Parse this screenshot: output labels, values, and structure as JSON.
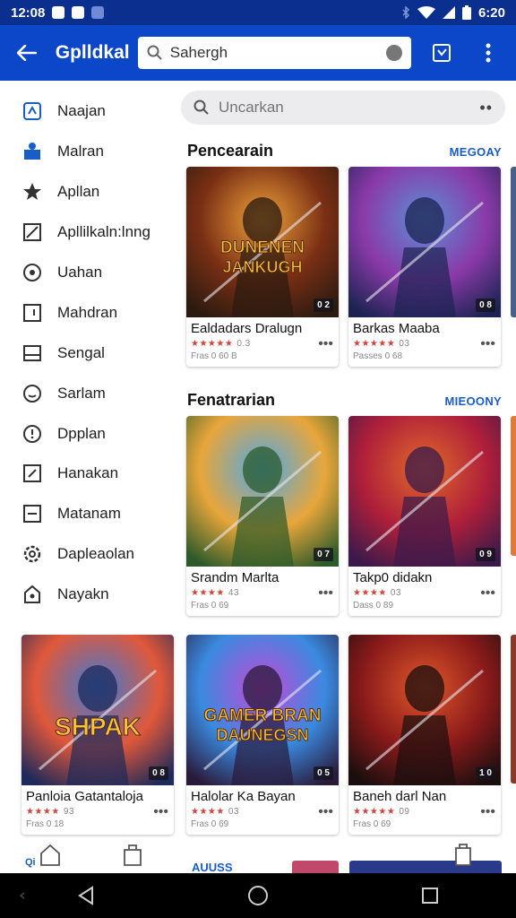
{
  "status_bar": {
    "time_left": "12:08",
    "time_right": "6:20",
    "icons": [
      "notification-icon",
      "notification-icon",
      "image-icon",
      "bluetooth-icon",
      "wifi-icon",
      "signal-icon",
      "battery-icon"
    ]
  },
  "app_bar": {
    "title": "Gplldkal",
    "search_value": "Sahergh",
    "icons": [
      "back-arrow-icon",
      "search-icon",
      "mic-icon",
      "bookmark-icon",
      "more-vert-icon"
    ]
  },
  "sidebar": {
    "items": [
      {
        "label": "Naajan",
        "icon": "home-icon"
      },
      {
        "label": "Malran",
        "icon": "store-icon"
      },
      {
        "label": "Apllan",
        "icon": "star-icon"
      },
      {
        "label": "Apllilkaln:lnng",
        "icon": "pencil-icon"
      },
      {
        "label": "Uahan",
        "icon": "compass-icon"
      },
      {
        "label": "Mahdran",
        "icon": "bookmark-icon"
      },
      {
        "label": "Sengal",
        "icon": "inbox-icon"
      },
      {
        "label": "Sarlam",
        "icon": "smile-icon"
      },
      {
        "label": "Dpplan",
        "icon": "info-icon"
      },
      {
        "label": "Hanakan",
        "icon": "edit-icon"
      },
      {
        "label": "Matanam",
        "icon": "minus-icon"
      },
      {
        "label": "Dapleaolan",
        "icon": "settings-icon"
      },
      {
        "label": "Nayakn",
        "icon": "bag-icon"
      }
    ]
  },
  "secondary_search": {
    "placeholder": "Uncarkan",
    "icons": [
      "search-icon",
      "more-horiz-icon"
    ]
  },
  "sections": [
    {
      "title": "Pencearain",
      "more": "MEGOAY"
    },
    {
      "title": "Fenatrarian",
      "more": "MIEOONY"
    }
  ],
  "cards": [
    {
      "name": "Ealdadars Dralugn",
      "stars": "★★★★★",
      "rating": "0.3",
      "sub": "Fras 0 60 B",
      "badge": "0 2",
      "art_title": "DUNENEN JANKUGH",
      "colors": [
        "#f0a33a",
        "#7a2f14",
        "#2a1a10"
      ]
    },
    {
      "name": "Barkas Maaba",
      "stars": "★★★★★",
      "rating": "03",
      "sub": "Passes 0 68",
      "badge": "0 8",
      "art_title": "",
      "colors": [
        "#5b8fd6",
        "#8a3aa8",
        "#1c2352"
      ]
    },
    {
      "name": "Srandm Marlta",
      "stars": "★★★★",
      "rating": "43",
      "sub": "Fras 0 69",
      "badge": "0 7",
      "art_title": "",
      "colors": [
        "#4fa8e8",
        "#e8a63a",
        "#2c5a2a"
      ]
    },
    {
      "name": "Takp0 didakn",
      "stars": "★★★★",
      "rating": "03",
      "sub": "Dass 0 89",
      "badge": "0 9",
      "art_title": "",
      "colors": [
        "#e06a2a",
        "#b01f3a",
        "#3a1a4a"
      ]
    },
    {
      "name": "Panloia Gatantaloja",
      "stars": "★★★★",
      "rating": "93",
      "sub": "Fras 0 18",
      "badge": "0 8",
      "art_title": "SHPAK",
      "colors": [
        "#3e7ad6",
        "#e0583a",
        "#1e2a5a"
      ]
    },
    {
      "name": "Halolar Ka Bayan",
      "stars": "★★★★",
      "rating": "03",
      "sub": "Fras 0 69",
      "badge": "0 5",
      "art_title": "GAMER BRAN DAUNEGSN",
      "colors": [
        "#c34ad6",
        "#3a8ae0",
        "#2a1a3a"
      ]
    },
    {
      "name": "Baneh darl Nan",
      "stars": "★★★★★",
      "rating": "09",
      "sub": "Fras 0 69",
      "badge": "1 0",
      "art_title": "",
      "colors": [
        "#e0582a",
        "#8a1a1a",
        "#1a0e0e"
      ]
    }
  ],
  "bottom": {
    "partial_label": "AUUSS",
    "tab_label": "Qi"
  },
  "nav_bar": {
    "icons": [
      "back-triangle-icon",
      "home-circle-icon",
      "recents-square-icon"
    ]
  }
}
